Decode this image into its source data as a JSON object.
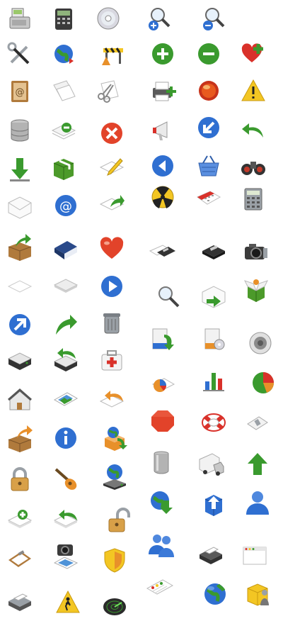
{
  "palette": {
    "background": "#ffffff",
    "green": "#3a9a2e",
    "blue": "#2f6fd1",
    "red": "#d9312a",
    "orange": "#e8902a",
    "yellow": "#f3c623",
    "gray": "#9aa0a6",
    "dark": "#2b2b2b",
    "brown": "#b07a3c"
  },
  "icons": [
    "cash-register-icon",
    "calculator-terminal-icon",
    "cd-disc-icon",
    "zoom-in-icon",
    "zoom-out-icon",
    "tools-icon",
    "globe-refresh-icon",
    "road-barrier-icon",
    "add-circle-icon",
    "remove-circle-icon",
    "heart-add-icon",
    "address-book-icon",
    "copy-pages-icon",
    "cut-scissors-icon",
    "printer-add-icon",
    "alarm-light-icon",
    "warning-icon",
    "database-icon",
    "page-remove-icon",
    "delete-x-icon",
    "megaphone-icon",
    "arrow-down-left-icon",
    "undo-arrow-icon",
    "download-arrow-icon",
    "package-icon",
    "edit-pencil-icon",
    "back-arrow-icon",
    "shopping-basket-icon",
    "binoculars-icon",
    "envelope-icon",
    "at-sign-icon",
    "page-forward-icon",
    "radiation-icon",
    "calendar-icon",
    "calculator-icon",
    "box-export-icon",
    "book-icon",
    "heart-icon",
    "floppy-page-icon",
    "floppy-disk-icon",
    "camera-icon",
    "blank-page-icon",
    "blank-card-icon",
    "play-icon",
    "search-icon",
    "mail-forward-icon",
    "open-box-green-icon",
    "arrow-up-right-icon",
    "arrow-up-right-green-icon",
    "trash-bin-icon",
    "box-install-icon",
    "box-cd-icon",
    "speaker-icon",
    "drive-icon",
    "drive-import-icon",
    "first-aid-kit-icon",
    "pie-chart-page-icon",
    "bar-chart-icon",
    "pie-chart-icon",
    "home-icon",
    "picture-icon",
    "page-undo-icon",
    "stop-octagon-icon",
    "lifebuoy-icon",
    "light-switch-icon",
    "box-open-orange-icon",
    "info-icon",
    "box-globe-icon",
    "trash-can-steel-icon",
    "delivery-truck-icon",
    "up-arrow-icon",
    "padlock-icon",
    "guitar-icon",
    "network-globe-drive-icon",
    "globe-download-icon",
    "box-upload-blue-icon",
    "user-icon",
    "page-add-icon",
    "page-reply-icon",
    "padlock-open-icon",
    "users-group-icon",
    "clipboard-icon",
    "camera-photos-icon",
    "security-shield-icon",
    "printer-icon",
    "window-app-icon",
    "printer-gray-icon",
    "pedestrian-sign-icon",
    "radar-icon",
    "window-list-icon",
    "globe-icon",
    "user-file-box-icon"
  ]
}
